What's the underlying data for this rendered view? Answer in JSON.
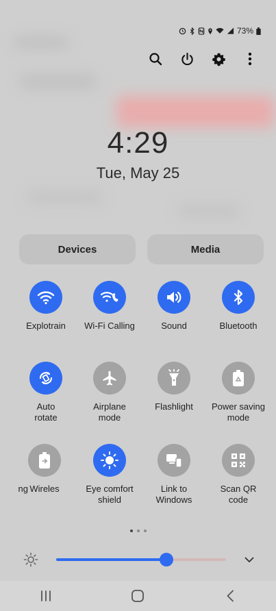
{
  "status": {
    "battery_text": "73%"
  },
  "toolbar": {
    "search": "search-icon",
    "power": "power-icon",
    "settings": "gear-icon",
    "more": "more-vertical-icon"
  },
  "clock": {
    "time": "4:29",
    "date": "Tue, May 25"
  },
  "pills": {
    "devices": "Devices",
    "media": "Media"
  },
  "tiles": [
    {
      "label": "Explotrain",
      "icon": "wifi-icon",
      "on": true
    },
    {
      "label": "Wi-Fi Calling",
      "icon": "wifi-calling-icon",
      "on": true
    },
    {
      "label": "Sound",
      "icon": "volume-icon",
      "on": true
    },
    {
      "label": "Bluetooth",
      "icon": "bluetooth-icon",
      "on": true
    },
    {
      "label": "Auto\nrotate",
      "icon": "auto-rotate-icon",
      "on": true
    },
    {
      "label": "Airplane\nmode",
      "icon": "airplane-icon",
      "on": false
    },
    {
      "label": "Flashlight",
      "icon": "flashlight-icon",
      "on": false
    },
    {
      "label": "Power saving\nmode",
      "icon": "power-saving-icon",
      "on": false
    },
    {
      "label": "ng",
      "icon": "partial-tile",
      "on": false
    },
    {
      "label": "Wireles",
      "icon": "wireless-share-icon",
      "on": false
    },
    {
      "label": "Eye comfort\nshield",
      "icon": "eye-comfort-icon",
      "on": true
    },
    {
      "label": "Link to\nWindows",
      "icon": "link-windows-icon",
      "on": false
    },
    {
      "label": "Scan QR\ncode",
      "icon": "qr-icon",
      "on": false
    }
  ],
  "pager": {
    "count": 3,
    "active": 0
  },
  "brightness": {
    "level": 0.65
  },
  "colors": {
    "accent": "#2f6bf0",
    "tile_off": "#a3a3a3"
  }
}
